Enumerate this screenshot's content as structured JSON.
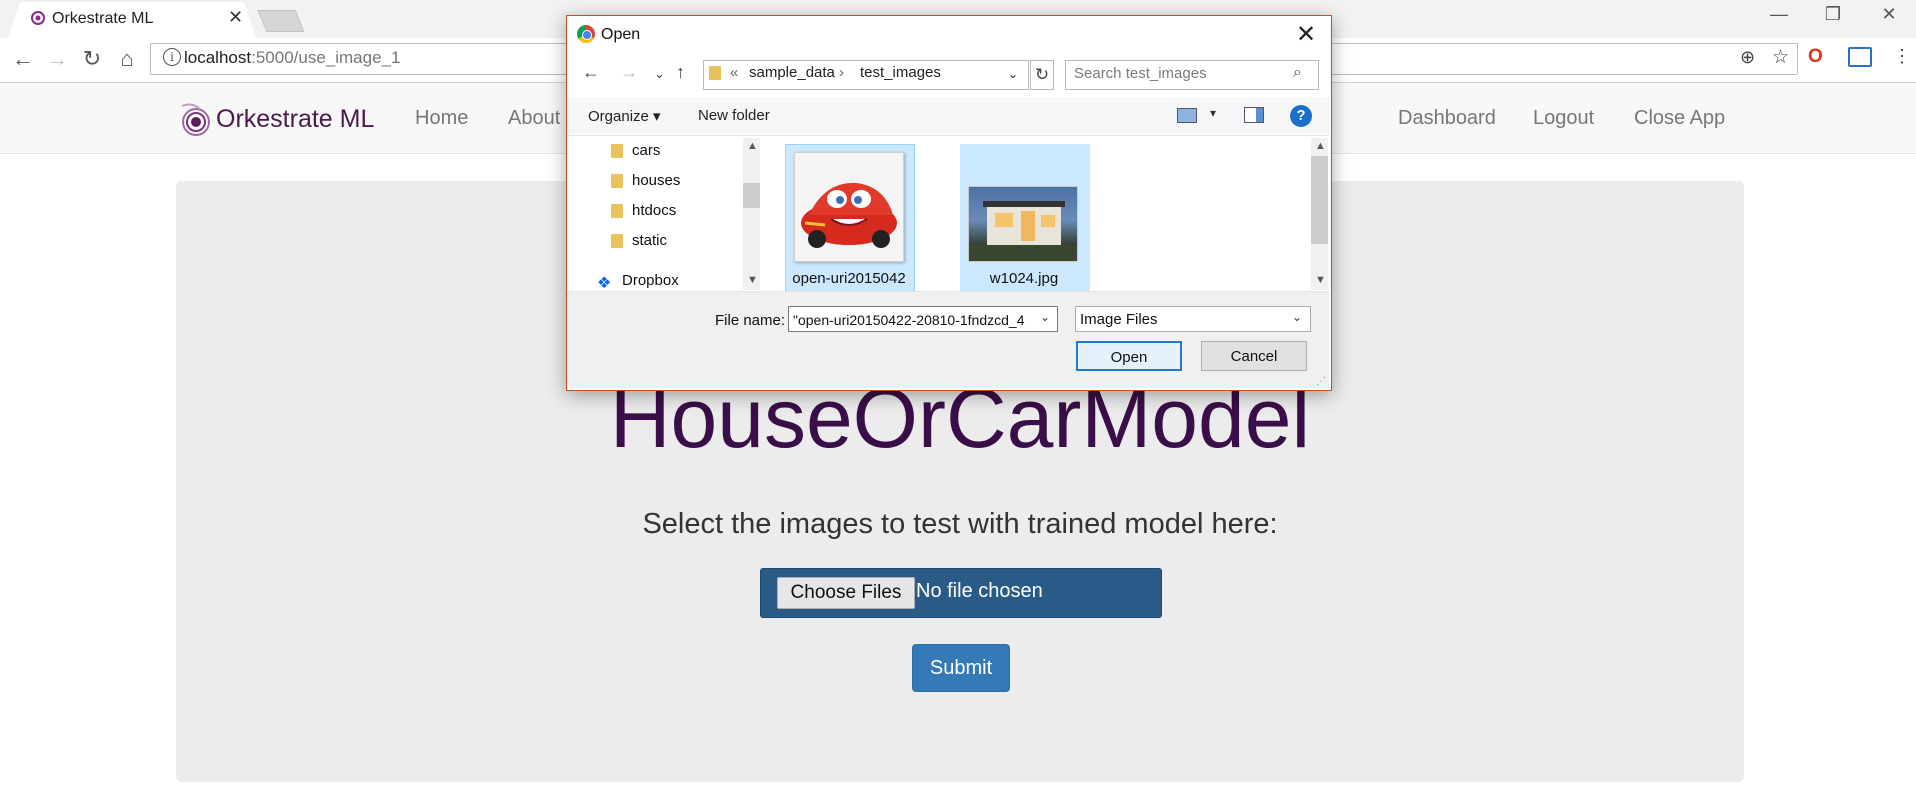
{
  "browser": {
    "tab_title": "Orkestrate ML",
    "tab_close": "✕",
    "url_host": "localhost",
    "url_path": ":5000/use_image_1"
  },
  "navbar": {
    "brand": "Orkestrate ML",
    "left_links": [
      "Home",
      "About"
    ],
    "right_links": [
      "Dashboard",
      "Logout",
      "Close App"
    ]
  },
  "page": {
    "title": "HouseOrCarModel",
    "instruction": "Select the images to test with trained model here:",
    "choose_files": "Choose Files",
    "no_file": "No file chosen",
    "submit": "Submit"
  },
  "dialog": {
    "title": "Open",
    "breadcrumb": [
      "sample_data",
      "test_images"
    ],
    "breadcrumb_prefix": "«",
    "search_placeholder": "Search test_images",
    "organize": "Organize ▾",
    "new_folder": "New folder",
    "tree": [
      "cars",
      "houses",
      "htdocs",
      "static",
      "Dropbox"
    ],
    "files": [
      {
        "name": "open-uri2015042",
        "kind": "car",
        "selected": true
      },
      {
        "name": "w1024.jpg",
        "kind": "house",
        "selected": true
      }
    ],
    "file_name_label": "File name:",
    "file_name_value": "\"open-uri20150422-20810-1fndzcd_4",
    "file_type": "Image Files",
    "open_button": "Open",
    "cancel_button": "Cancel"
  },
  "colors": {
    "brand": "#4a1a4a",
    "title": "#3a0e48",
    "file_box": "#2a5b86",
    "submit": "#337ab7",
    "selection": "#cce8ff",
    "dialog_border": "#c3501f"
  }
}
